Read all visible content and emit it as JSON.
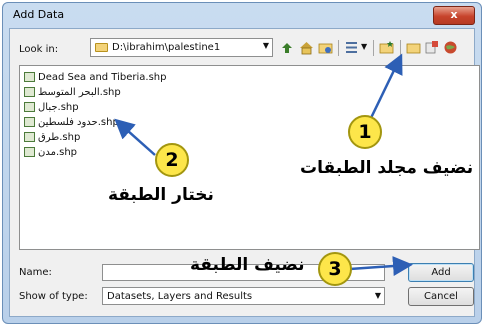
{
  "window": {
    "title": "Add Data",
    "close_label": "x"
  },
  "look_in": {
    "label": "Look in:",
    "path": "D:\\ibrahim\\palestine1"
  },
  "toolbar": {
    "icons": [
      "up-folder-icon",
      "home-icon",
      "connect-folder-icon",
      "list-view-icon",
      "new-folder-icon",
      "folder-open-icon",
      "database-icon",
      "globe-icon"
    ]
  },
  "files": [
    {
      "name": "Dead Sea and Tiberia.shp",
      "icon": "polygon-shapefile-icon"
    },
    {
      "name": "البحر المتوسط.shp",
      "icon": "polygon-shapefile-icon"
    },
    {
      "name": "جبال.shp",
      "icon": "point-shapefile-icon"
    },
    {
      "name": "حدود فلسطين.shp",
      "icon": "polygon-shapefile-icon"
    },
    {
      "name": "طرق.shp",
      "icon": "line-shapefile-icon"
    },
    {
      "name": "مدن.shp",
      "icon": "point-shapefile-icon"
    }
  ],
  "name_field": {
    "label": "Name:",
    "value": ""
  },
  "type_field": {
    "label": "Show of type:",
    "value": "Datasets, Layers and Results"
  },
  "buttons": {
    "add": "Add",
    "cancel": "Cancel"
  },
  "annotations": {
    "step1": {
      "number": "1",
      "text": "نضيف مجلد الطبقات"
    },
    "step2": {
      "number": "2",
      "text": "نختار الطبقة"
    },
    "step3": {
      "number": "3",
      "text": "نضيف الطبقة"
    }
  },
  "colors": {
    "callout": "#fde64a",
    "arrow": "#2d5fb5",
    "close": "#c7442c"
  }
}
